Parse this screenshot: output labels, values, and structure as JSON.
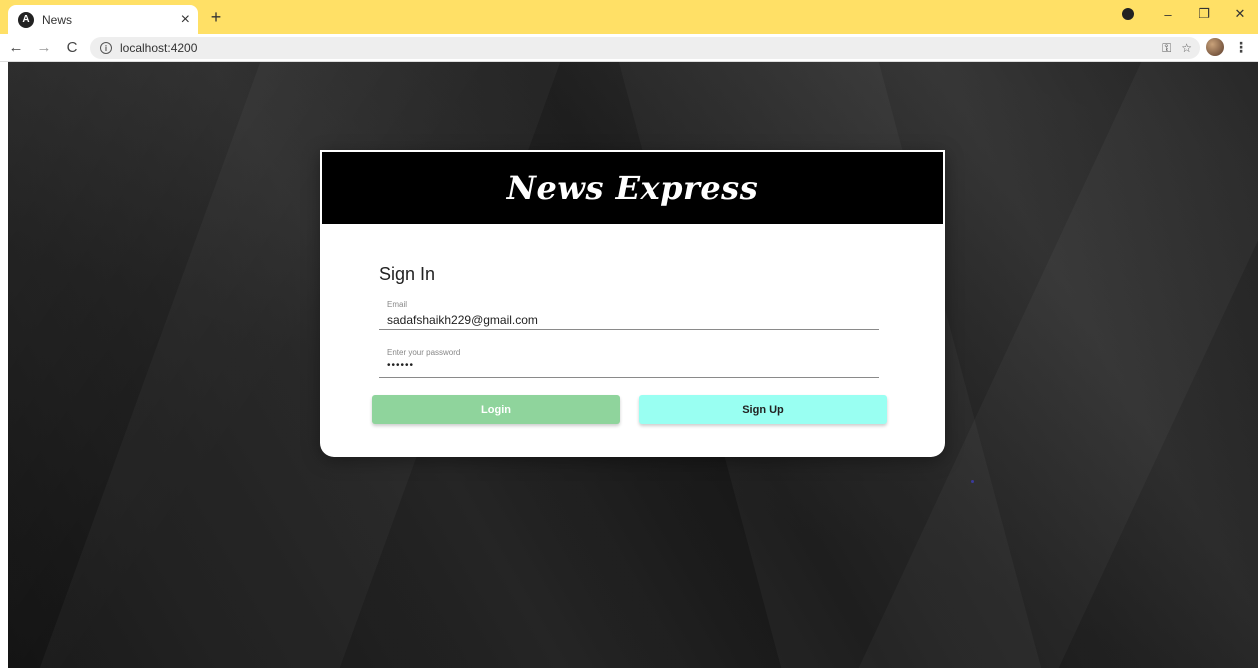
{
  "browser": {
    "tab_title": "News",
    "tab_close": "×",
    "new_tab": "+",
    "url": "localhost:4200",
    "window_controls": {
      "minimize": "–",
      "restore": "❐",
      "close": "✕"
    }
  },
  "card": {
    "brand": "News Express",
    "signin_title": "Sign In",
    "email": {
      "label": "Email",
      "value": "sadafshaikh229@gmail.com"
    },
    "password": {
      "label": "Enter your password",
      "value": "••••••"
    },
    "login_label": "Login",
    "signup_label": "Sign Up"
  },
  "colors": {
    "tabstrip": "#ffe066",
    "login_button": "#8fd49c",
    "signup_button": "#99fff2",
    "header": "#000000"
  },
  "icons": [
    "angular-favicon",
    "back-arrow-icon",
    "forward-arrow-icon",
    "reload-icon",
    "info-icon",
    "key-icon",
    "star-icon",
    "avatar",
    "menu-dots-icon"
  ]
}
